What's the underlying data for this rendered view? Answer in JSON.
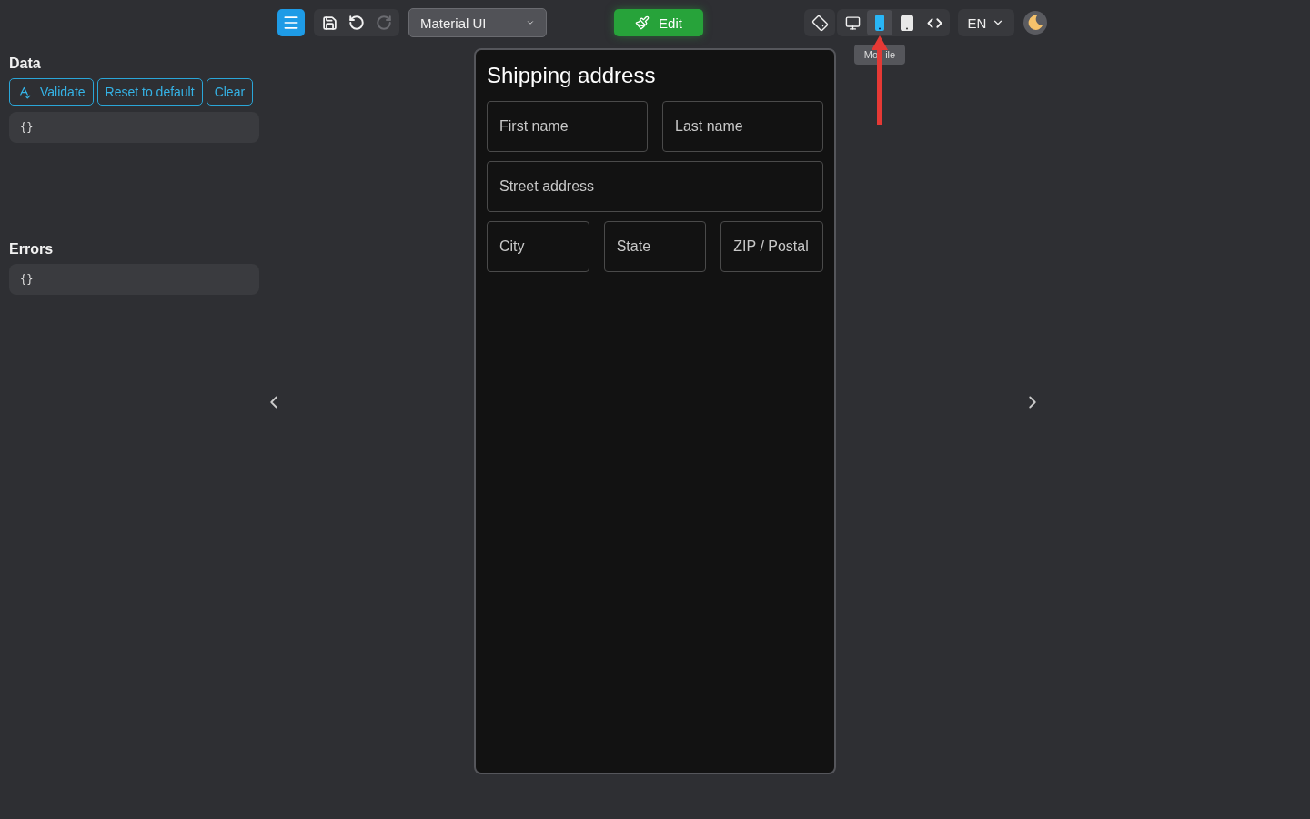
{
  "toolbar": {
    "redo": {
      "disabled": true
    },
    "theme_select": {
      "value": "Material UI"
    },
    "edit_button": {
      "label": "Edit"
    },
    "device_buttons": [
      {
        "kind": "desktop",
        "selected": false
      },
      {
        "kind": "mobile",
        "selected": true
      },
      {
        "kind": "tablet",
        "selected": false
      },
      {
        "kind": "code",
        "selected": false
      }
    ],
    "tooltip": {
      "parts": [
        "Mo",
        "ile"
      ]
    },
    "language": {
      "value": "EN"
    }
  },
  "data_panel": {
    "title": "Data",
    "buttons": [
      {
        "kind": "validate",
        "label": "Validate"
      },
      {
        "kind": "plain",
        "label": "Reset to default"
      },
      {
        "kind": "plain",
        "label": "Clear"
      }
    ],
    "value": "{}"
  },
  "errors_panel": {
    "title": "Errors",
    "value": "{}"
  },
  "form": {
    "title": "Shipping address",
    "rows": [
      [
        {
          "placeholder": "First name"
        },
        {
          "placeholder": "Last name"
        }
      ],
      [
        {
          "placeholder": "Street address"
        }
      ],
      [
        {
          "placeholder": "City"
        },
        {
          "placeholder": "State"
        },
        {
          "placeholder": "ZIP / Postal"
        }
      ]
    ]
  }
}
